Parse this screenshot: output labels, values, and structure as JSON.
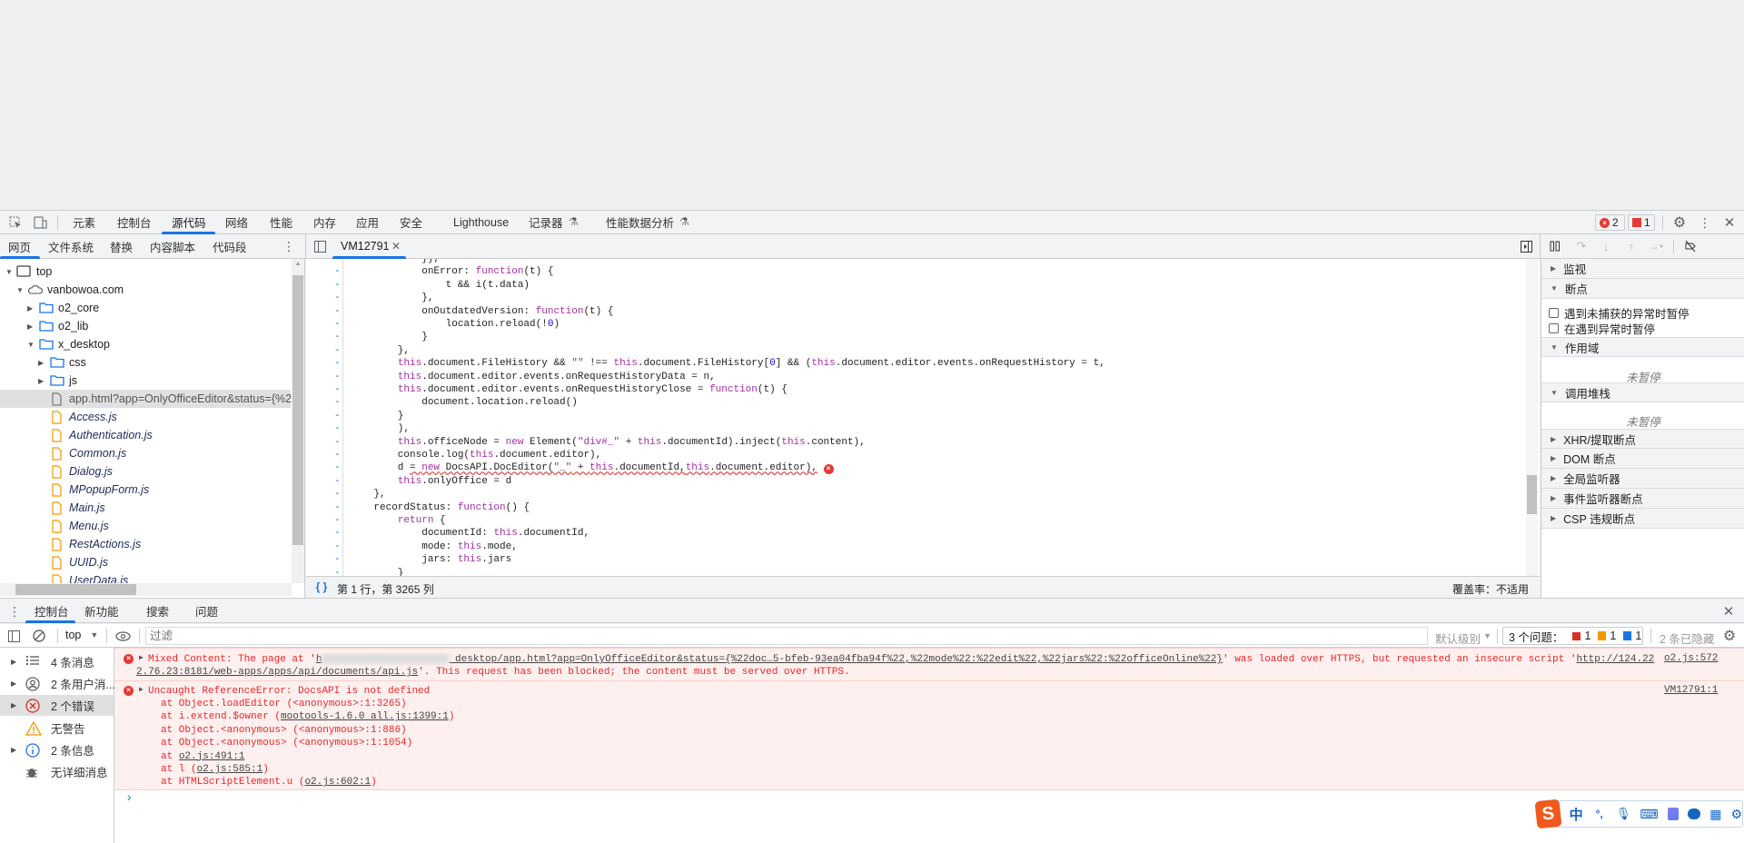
{
  "devtools": {
    "main_tabs": [
      "元素",
      "控制台",
      "源代码",
      "网络",
      "性能",
      "内存",
      "应用",
      "安全",
      "Lighthouse",
      "记录器",
      "性能数据分析"
    ],
    "active_main_tab": "源代码",
    "error_badge_count": "2",
    "issue_badge_count": "1"
  },
  "sources": {
    "nav_tabs": [
      "网页",
      "文件系统",
      "替换",
      "内容脚本",
      "代码段"
    ],
    "tree": [
      {
        "label": "top",
        "type": "frame",
        "depth": 0,
        "arrow": "open"
      },
      {
        "label": "vanbowoa.com",
        "type": "cloud",
        "depth": 1,
        "arrow": "open"
      },
      {
        "label": "o2_core",
        "type": "folder",
        "depth": 2,
        "arrow": "closed"
      },
      {
        "label": "o2_lib",
        "type": "folder",
        "depth": 2,
        "arrow": "closed"
      },
      {
        "label": "x_desktop",
        "type": "folder",
        "depth": 2,
        "arrow": "open"
      },
      {
        "label": "css",
        "type": "folder",
        "depth": 3,
        "arrow": "closed"
      },
      {
        "label": "js",
        "type": "folder",
        "depth": 3,
        "arrow": "closed"
      },
      {
        "label": "app.html?app=OnlyOfficeEditor&status={%22",
        "type": "doc",
        "depth": 3,
        "selected": true
      },
      {
        "label": "Access.js",
        "type": "js",
        "depth": 3
      },
      {
        "label": "Authentication.js",
        "type": "js",
        "depth": 3
      },
      {
        "label": "Common.js",
        "type": "js",
        "depth": 3
      },
      {
        "label": "Dialog.js",
        "type": "js",
        "depth": 3
      },
      {
        "label": "MPopupForm.js",
        "type": "js",
        "depth": 3
      },
      {
        "label": "Main.js",
        "type": "js",
        "depth": 3
      },
      {
        "label": "Menu.js",
        "type": "js",
        "depth": 3
      },
      {
        "label": "RestActions.js",
        "type": "js",
        "depth": 3
      },
      {
        "label": "UUID.js",
        "type": "js",
        "depth": 3
      },
      {
        "label": "UserData.js",
        "type": "js",
        "depth": 3
      }
    ],
    "editor_tab": "VM12791",
    "code_lines": [
      "            }},",
      "            onError: function(t) {",
      "                t && i(t.data)",
      "            },",
      "            onOutdatedVersion: function(t) {",
      "                location.reload(!0)",
      "            }",
      "        },",
      "        this.document.FileHistory && \"\" !== this.document.FileHistory[0] && (this.document.editor.events.onRequestHistory = t,",
      "        this.document.editor.events.onRequestHistoryData = n,",
      "        this.document.editor.events.onRequestHistoryClose = function(t) {",
      "            document.location.reload()",
      "        }",
      "        ),",
      "        this.officeNode = new Element(\"div#_\" + this.documentId).inject(this.content),",
      "        console.log(this.document.editor),",
      "        d = new DocsAPI.DocEditor(\"_\" + this.documentId,this.document.editor),",
      "        this.onlyOffice = d",
      "    },",
      "    recordStatus: function() {",
      "        return {",
      "            documentId: this.documentId,",
      "            mode: this.mode,",
      "            jars: this.jars",
      "        }"
    ],
    "error_line_index": 16,
    "status_position": "第 1 行，第 3265 列",
    "coverage": "覆盖率：不适用"
  },
  "debugger": {
    "watch": "监视",
    "breakpoints": "断点",
    "pause_uncaught": "遇到未捕获的异常时暂停",
    "pause_caught": "在遇到异常时暂停",
    "scope": "作用域",
    "not_paused": "未暂停",
    "call_stack": "调用堆栈",
    "xhr": "XHR/提取断点",
    "dom": "DOM 断点",
    "global": "全局监听器",
    "event": "事件监听器断点",
    "csp": "CSP 违规断点"
  },
  "drawer": {
    "tabs": [
      "控制台",
      "新功能",
      "搜索",
      "问题"
    ],
    "context": "top",
    "filter_placeholder": "过滤",
    "level": "默认级别",
    "issues_label": "3 个问题：",
    "issues_error": "1",
    "issues_warning": "1",
    "issues_info": "1",
    "hidden": "2 条已隐藏",
    "sidebar": [
      {
        "label": "4 条消息",
        "icon": "list"
      },
      {
        "label": "2 条用户消...",
        "icon": "user"
      },
      {
        "label": "2 个错误",
        "icon": "error",
        "selected": true
      },
      {
        "label": "无警告",
        "icon": "warning"
      },
      {
        "label": "2 条信息",
        "icon": "info"
      },
      {
        "label": "无详细消息",
        "icon": "bug"
      }
    ],
    "msg1": {
      "pre": "Mixed Content: The page at '",
      "link_a": "h",
      "link_b": " desktop/app.html?app=OnlyOfficeEditor&status={%22doc…5-bfeb-93ea04fba94f%22,%22mode%22:%22edit%22,%22jars%22:%22officeOnline%22}",
      "mid": "' was loaded over HTTPS, but requested an insecure script '",
      "link_c": "http://124.22",
      "line2_link": "2.76.23:8181/web-apps/apps/api/documents/api.js",
      "line2_post": "'. This request has been blocked; the content must be served over HTTPS.",
      "source": "o2.js:572"
    },
    "msg2": {
      "title": "Uncaught ReferenceError: DocsAPI is not defined",
      "source": "VM12791:1",
      "stack": [
        {
          "pre": "at Object.loadEditor (<anonymous>:1:3265)",
          "link": "",
          "post": ""
        },
        {
          "pre": "at i.extend.$owner (",
          "link": "mootools-1.6.0 all.js:1399:1",
          "post": ")"
        },
        {
          "pre": "at Object.<anonymous> (<anonymous>:1:886)",
          "link": "",
          "post": ""
        },
        {
          "pre": "at Object.<anonymous> (<anonymous>:1:1054)",
          "link": "",
          "post": ""
        },
        {
          "pre": "at ",
          "link": "o2.js:491:1",
          "post": ""
        },
        {
          "pre": "at l (",
          "link": "o2.js:585:1",
          "post": ")"
        },
        {
          "pre": "at HTMLScriptElement.u (",
          "link": "o2.js:602:1",
          "post": ")"
        }
      ]
    },
    "prompt": "›"
  },
  "ime": {
    "lang": "中",
    "punct": "°,"
  },
  "colors": {
    "accent": "#1a73e8",
    "error": "#e8262a",
    "error_bg": "#fef0ef"
  }
}
